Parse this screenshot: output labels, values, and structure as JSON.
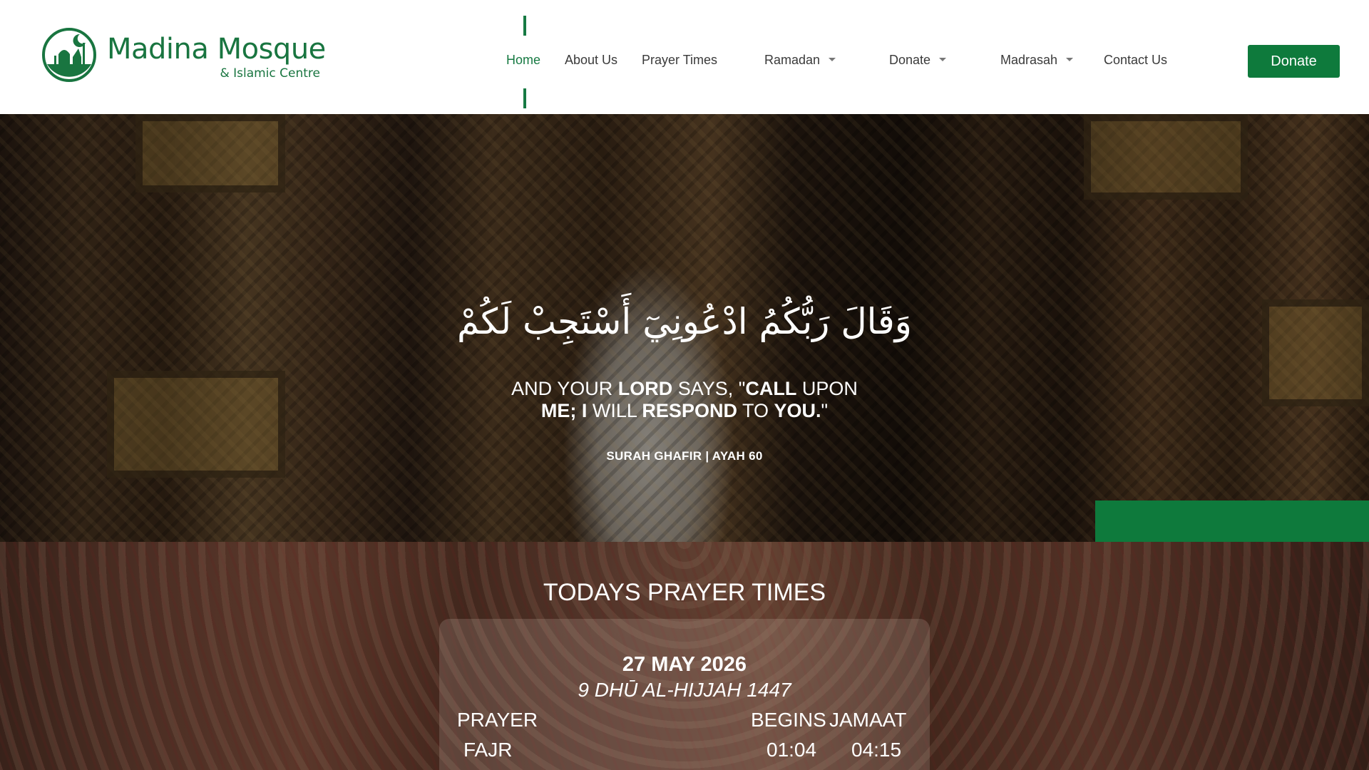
{
  "logo": {
    "name": "Madina Mosque",
    "subtitle": "& Islamic Centre",
    "brand_color": "#197540"
  },
  "nav": {
    "items": [
      {
        "label": "Home",
        "active": true
      },
      {
        "label": "About Us"
      },
      {
        "label": "Prayer Times"
      },
      {
        "label": "Ramadan",
        "dropdown": true
      },
      {
        "label": "Donate",
        "dropdown": true
      },
      {
        "label": "Madrasah",
        "dropdown": true
      },
      {
        "label": "Contact Us"
      }
    ],
    "cta_label": "Donate",
    "accent_color": "#0e7a3c"
  },
  "hero": {
    "arabic": "وَقَالَ رَبُّكُمُ ادْعُونِيٓ أَسْتَجِبْ لَكُمْ",
    "translation": {
      "line1": [
        {
          "t": "AND YOUR ",
          "b": false
        },
        {
          "t": "LORD",
          "b": true
        },
        {
          "t": " SAYS, \"",
          "b": false
        },
        {
          "t": "CALL",
          "b": true
        },
        {
          "t": " UPON",
          "b": false
        }
      ],
      "line2": [
        {
          "t": "ME; I",
          "b": true
        },
        {
          "t": " WILL ",
          "b": false
        },
        {
          "t": "RESPOND",
          "b": true
        },
        {
          "t": " TO ",
          "b": false
        },
        {
          "t": "YOU.",
          "b": true
        },
        {
          "t": "\"",
          "b": false
        }
      ]
    },
    "reference": "SURAH GHAFIR | AYAH 60"
  },
  "prayer_times": {
    "title": "TODAYS PRAYER TIMES",
    "date": "27 MAY 2026",
    "hijri_date": "9 DHŪ AL-HIJJAH 1447",
    "headers": {
      "prayer": "PRAYER",
      "begins": "BEGINS",
      "jamaat": "JAMAAT"
    },
    "rows": [
      {
        "prayer": "FAJR",
        "begins": "01:04",
        "jamaat": "04:15"
      }
    ]
  }
}
